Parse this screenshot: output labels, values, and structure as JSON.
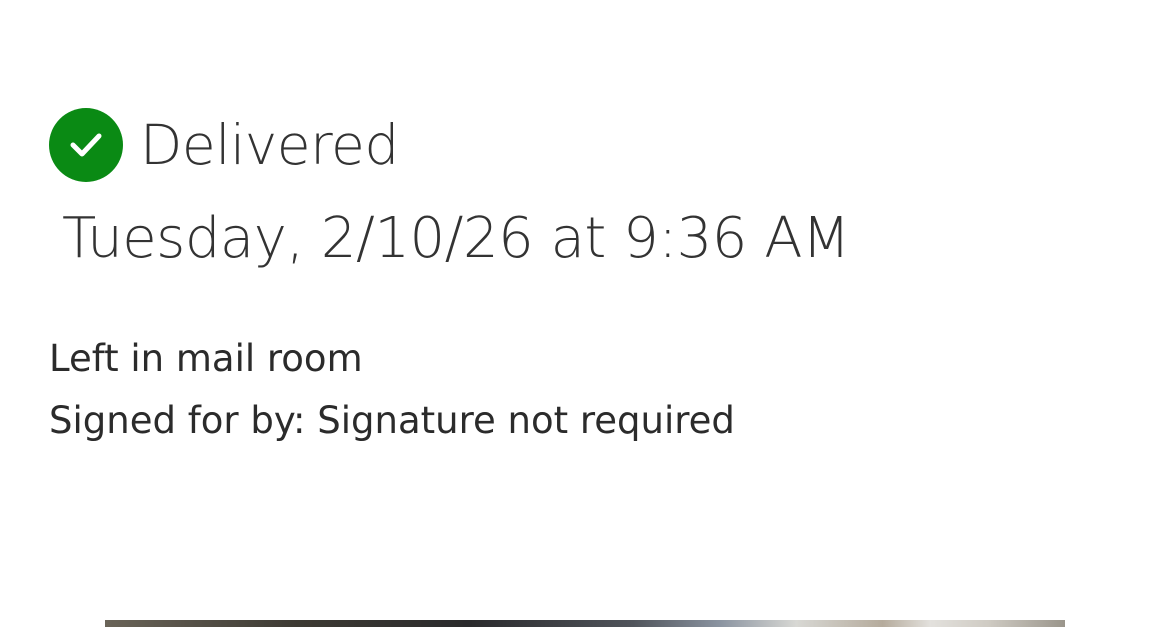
{
  "status": {
    "label": "Delivered",
    "icon": "check-circle-icon",
    "color": "#0a8a14"
  },
  "delivery": {
    "datetime": "Tuesday, 2/10/26 at 9:36 AM",
    "location": "Left in mail room",
    "signature": "Signed for by: Signature not required"
  }
}
